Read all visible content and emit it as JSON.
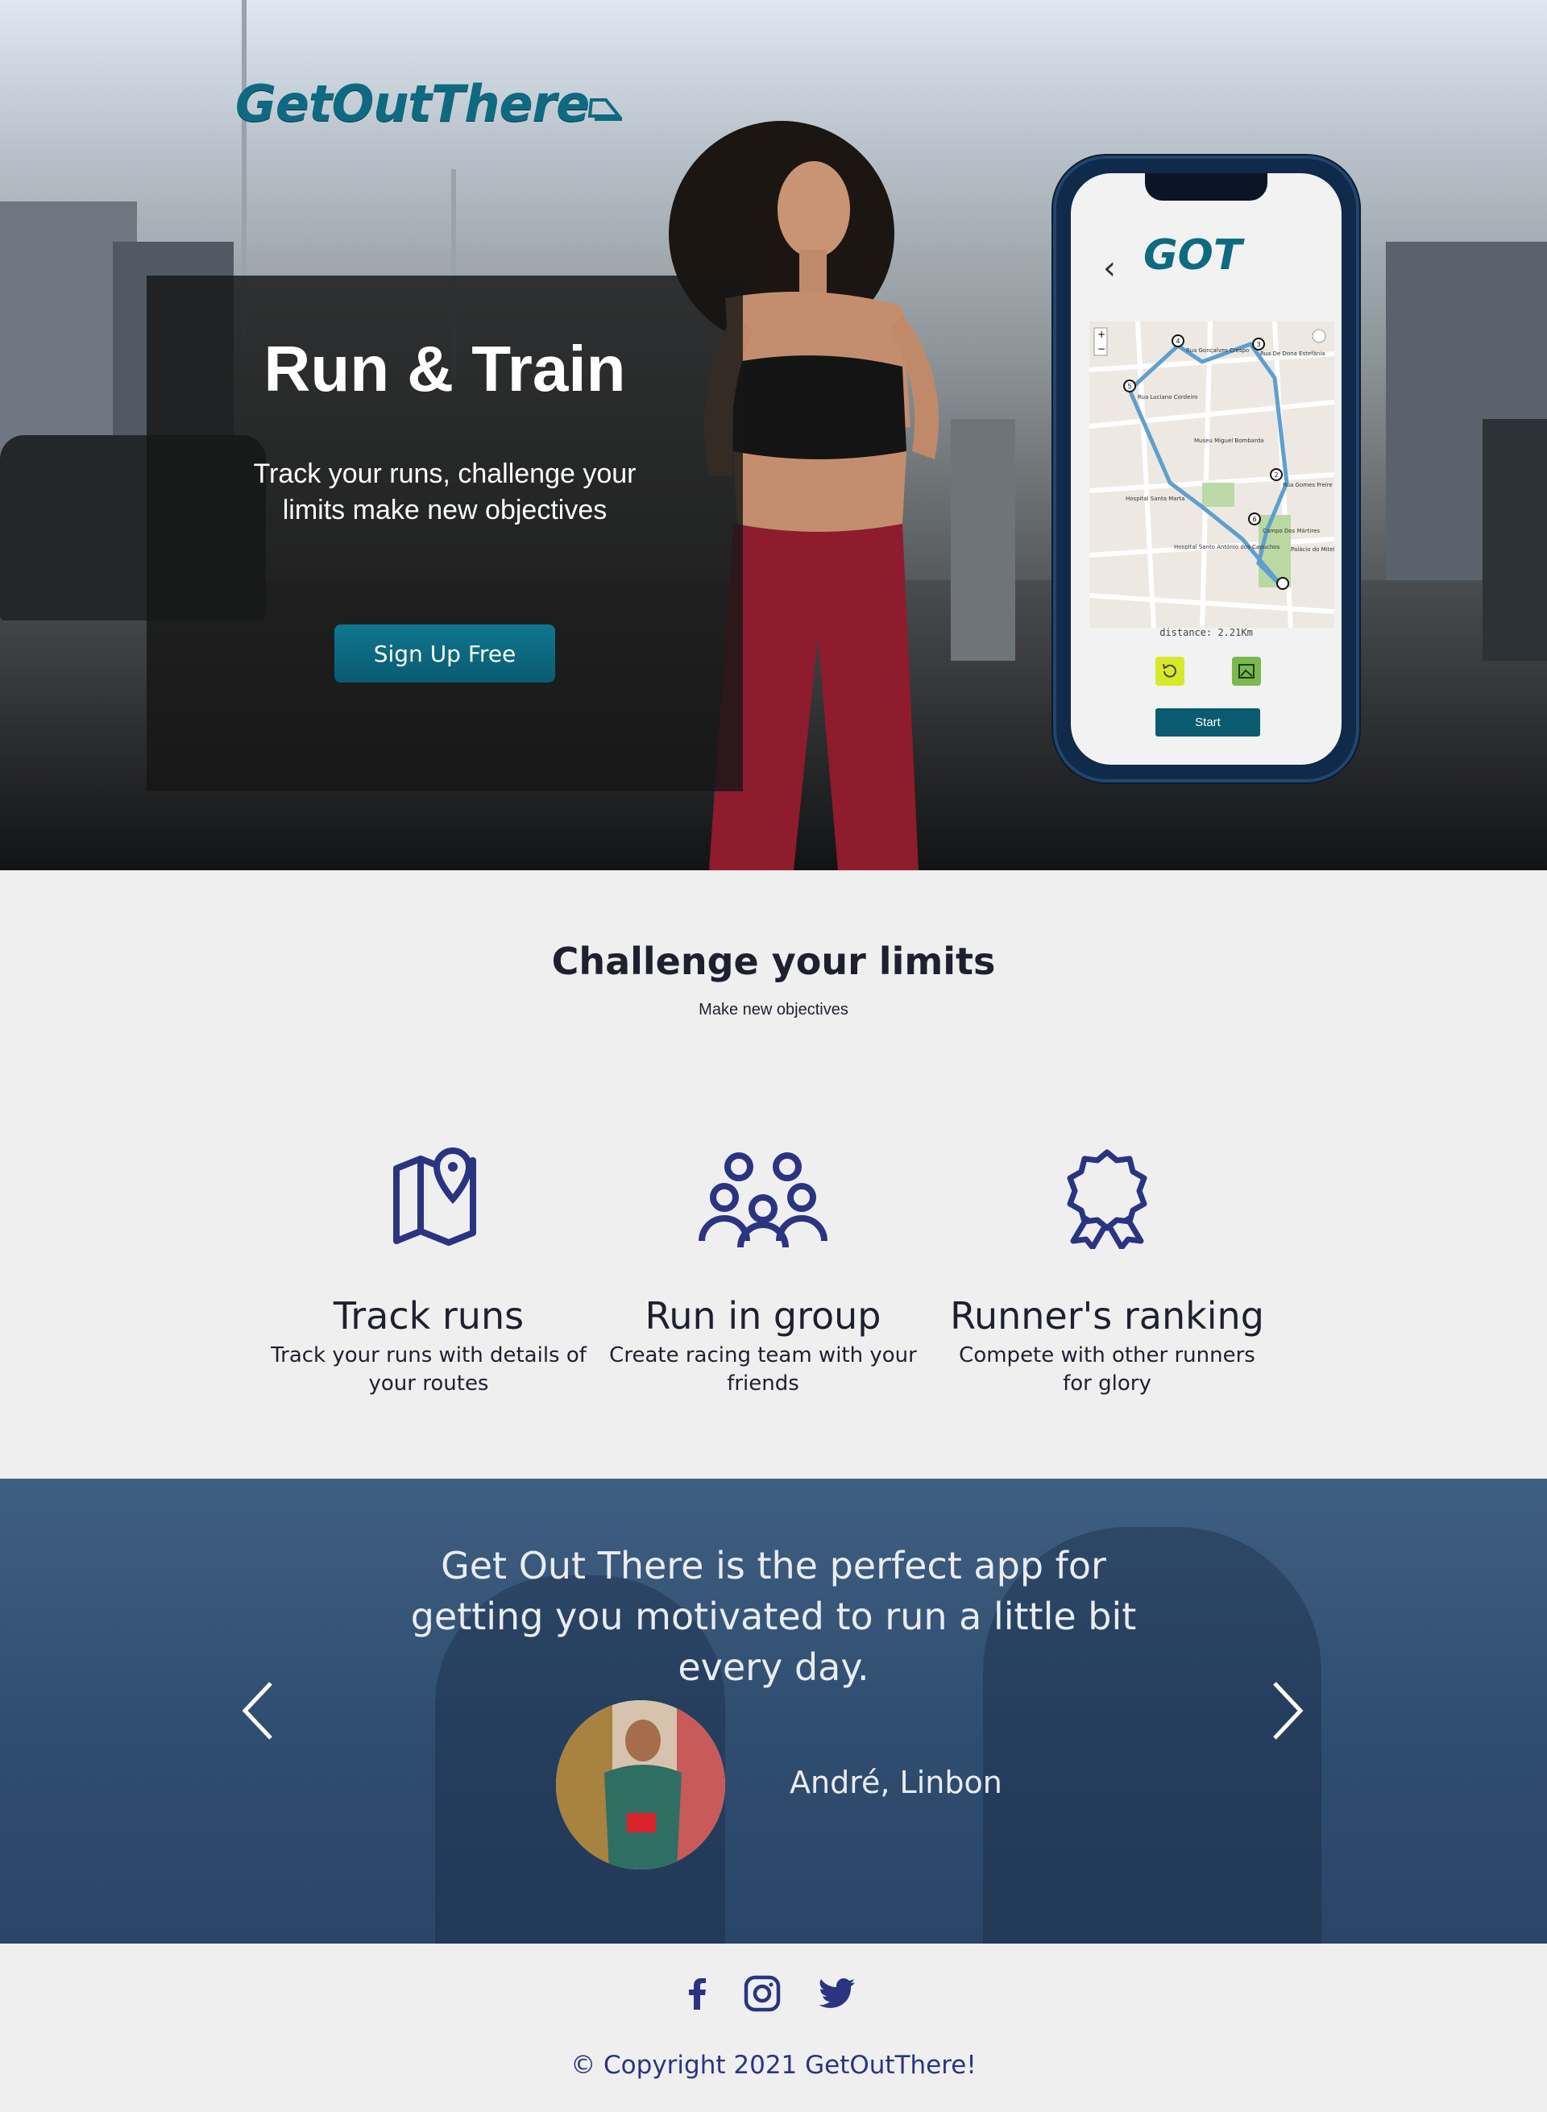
{
  "brand": {
    "logo_text": "GetOutThere",
    "app_logo_text": "GOT"
  },
  "hero": {
    "title": "Run & Train",
    "subtitle": "Track your runs, challenge your limits make new objectives",
    "cta_label": "Sign Up Free"
  },
  "phone_app": {
    "back_icon": "chevron-left-icon",
    "map_labels": [
      "Rua Gonçalves Crespo",
      "Rua De Dona Estefânia",
      "Rua Luciano Cordeiro",
      "Museu Miguel Bombarda",
      "Rua Gomes Freire",
      "Campo Dos Mártires",
      "Palácio do Mitelo",
      "Hospital Santo António dos Capuchos",
      "Hospital Santa Marta"
    ],
    "route_markers": [
      "1",
      "2",
      "3",
      "4",
      "5",
      "6"
    ],
    "distance": "distance: 2.21Km",
    "start_label": "Start"
  },
  "features": {
    "title": "Challenge your limits",
    "subtitle": "Make new objectives",
    "items": [
      {
        "icon": "map-pin-icon",
        "title": "Track runs",
        "desc": "Track your runs with details of your routes"
      },
      {
        "icon": "group-icon",
        "title": "Run in group",
        "desc": "Create racing team with your friends"
      },
      {
        "icon": "award-ribbon-icon",
        "title": "Runner's ranking",
        "desc": "Compete with other runners for glory"
      }
    ]
  },
  "testimonial": {
    "quote": "Get Out There is the perfect app for getting you motivated to run a little bit every day.",
    "author": "André, Linbon"
  },
  "footer": {
    "social": [
      "facebook-icon",
      "instagram-icon",
      "twitter-icon"
    ],
    "copyright": "© Copyright 2021 GetOutThere!"
  },
  "colors": {
    "accent": "#0a5b70",
    "icon_blue": "#2b3481",
    "testimonial_bg": "#2f4d6f"
  }
}
